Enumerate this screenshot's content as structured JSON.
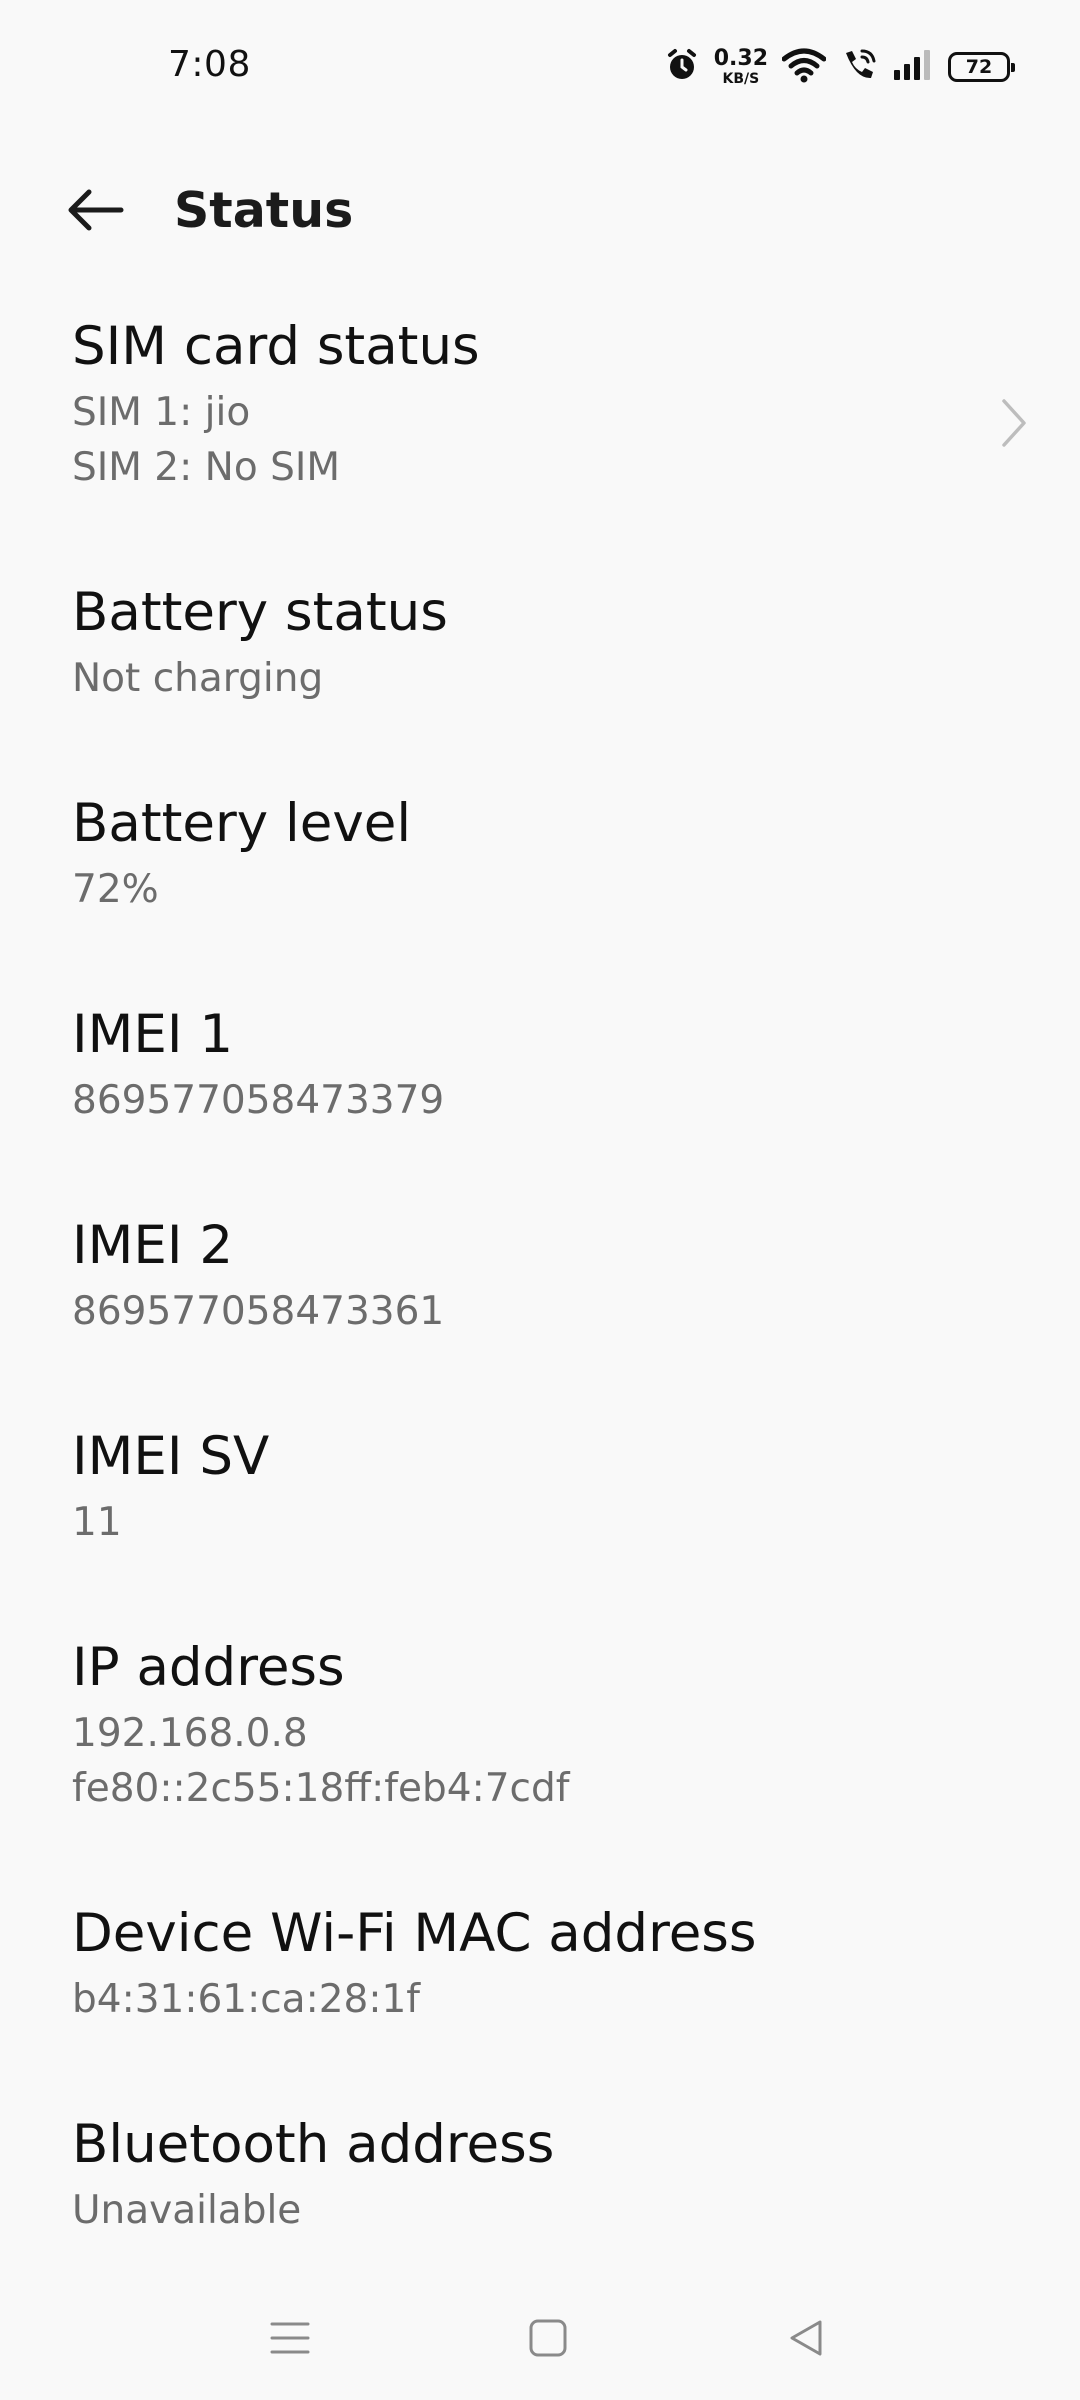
{
  "status_bar": {
    "time": "7:08",
    "net_speed_value": "0.32",
    "net_speed_unit": "KB/S",
    "battery_level": "72",
    "icons": [
      "alarm-icon",
      "wifi-icon",
      "wifi-calling-icon",
      "signal-icon",
      "battery-icon"
    ]
  },
  "header": {
    "back_icon": "back-arrow-icon",
    "title": "Status"
  },
  "items": [
    {
      "title": "SIM card status",
      "lines": [
        "SIM 1: jio",
        "SIM 2: No SIM"
      ],
      "chevron": true
    },
    {
      "title": "Battery status",
      "lines": [
        "Not charging"
      ]
    },
    {
      "title": "Battery level",
      "lines": [
        "72%"
      ]
    },
    {
      "title": "IMEI 1",
      "lines": [
        "869577058473379"
      ]
    },
    {
      "title": "IMEI 2",
      "lines": [
        "869577058473361"
      ]
    },
    {
      "title": "IMEI SV",
      "lines": [
        "11"
      ]
    },
    {
      "title": "IP address",
      "lines": [
        "192.168.0.8",
        "fe80::2c55:18ff:feb4:7cdf"
      ]
    },
    {
      "title": "Device Wi-Fi MAC address",
      "lines": [
        "b4:31:61:ca:28:1f"
      ]
    },
    {
      "title": "Bluetooth address",
      "lines": [
        "Unavailable"
      ]
    }
  ],
  "nav_bar": {
    "buttons": [
      "menu-icon",
      "home-icon",
      "back-icon"
    ]
  },
  "colors": {
    "background": "#f9f9f9",
    "primary_text": "#111111",
    "secondary_text": "#6c6c6c",
    "chevron": "#bdbdbd"
  }
}
